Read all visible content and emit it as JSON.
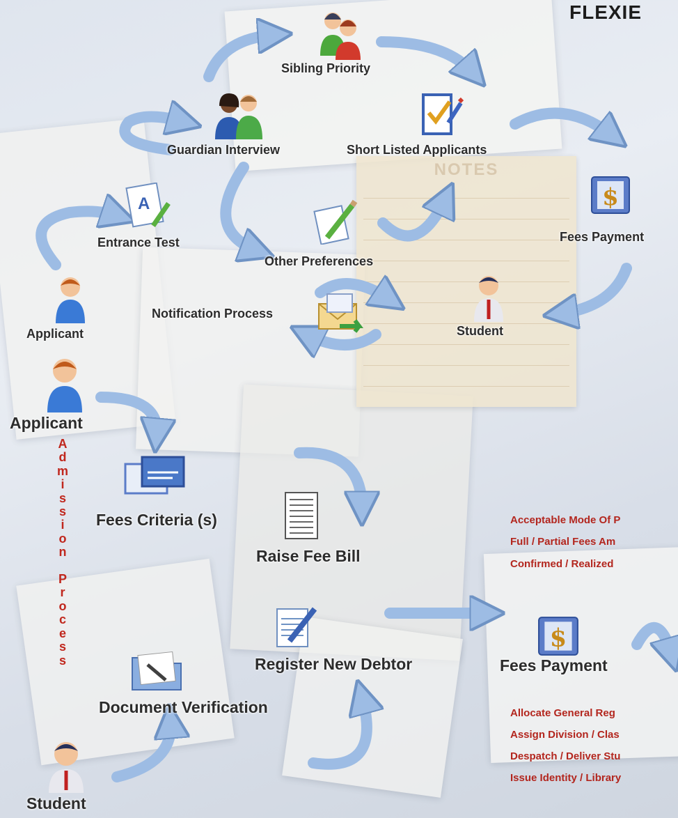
{
  "title": "FLEXIE",
  "labels": {
    "sibling_priority": "Sibling Priority",
    "guardian_interview": "Guardian Interview",
    "short_listed": "Short Listed Applicants",
    "entrance_test": "Entrance Test",
    "other_preferences": "Other Preferences",
    "fees_payment_top": "Fees Payment",
    "notification_process": "Notification Process",
    "applicant_1": "Applicant",
    "student_1": "Student",
    "applicant_2": "Applicant",
    "fees_criteria": "Fees Criteria (s)",
    "raise_fee_bill": "Raise Fee Bill",
    "register_new_debtor": "Register New Debtor",
    "fees_payment_bottom": "Fees Payment",
    "document_verification": "Document Verification",
    "student_2": "Student"
  },
  "notes_header": "NOTES",
  "vertical_text": [
    "A",
    "d",
    "m",
    "i",
    "s",
    "s",
    "i",
    "o",
    "n",
    "",
    "P",
    "r",
    "o",
    "c",
    "e",
    "s",
    "s"
  ],
  "payment_details": [
    "Acceptable Mode Of P",
    "Full / Partial Fees Am",
    "Confirmed / Realized"
  ],
  "post_payment_steps": [
    "Allocate General Reg",
    "Assign Division / Clas",
    "Despatch / Deliver Stu",
    "Issue Identity / Library"
  ],
  "colors": {
    "arrow_fill": "#9dbce4",
    "arrow_stroke": "#6f93c4",
    "red_text": "#b3261e"
  }
}
